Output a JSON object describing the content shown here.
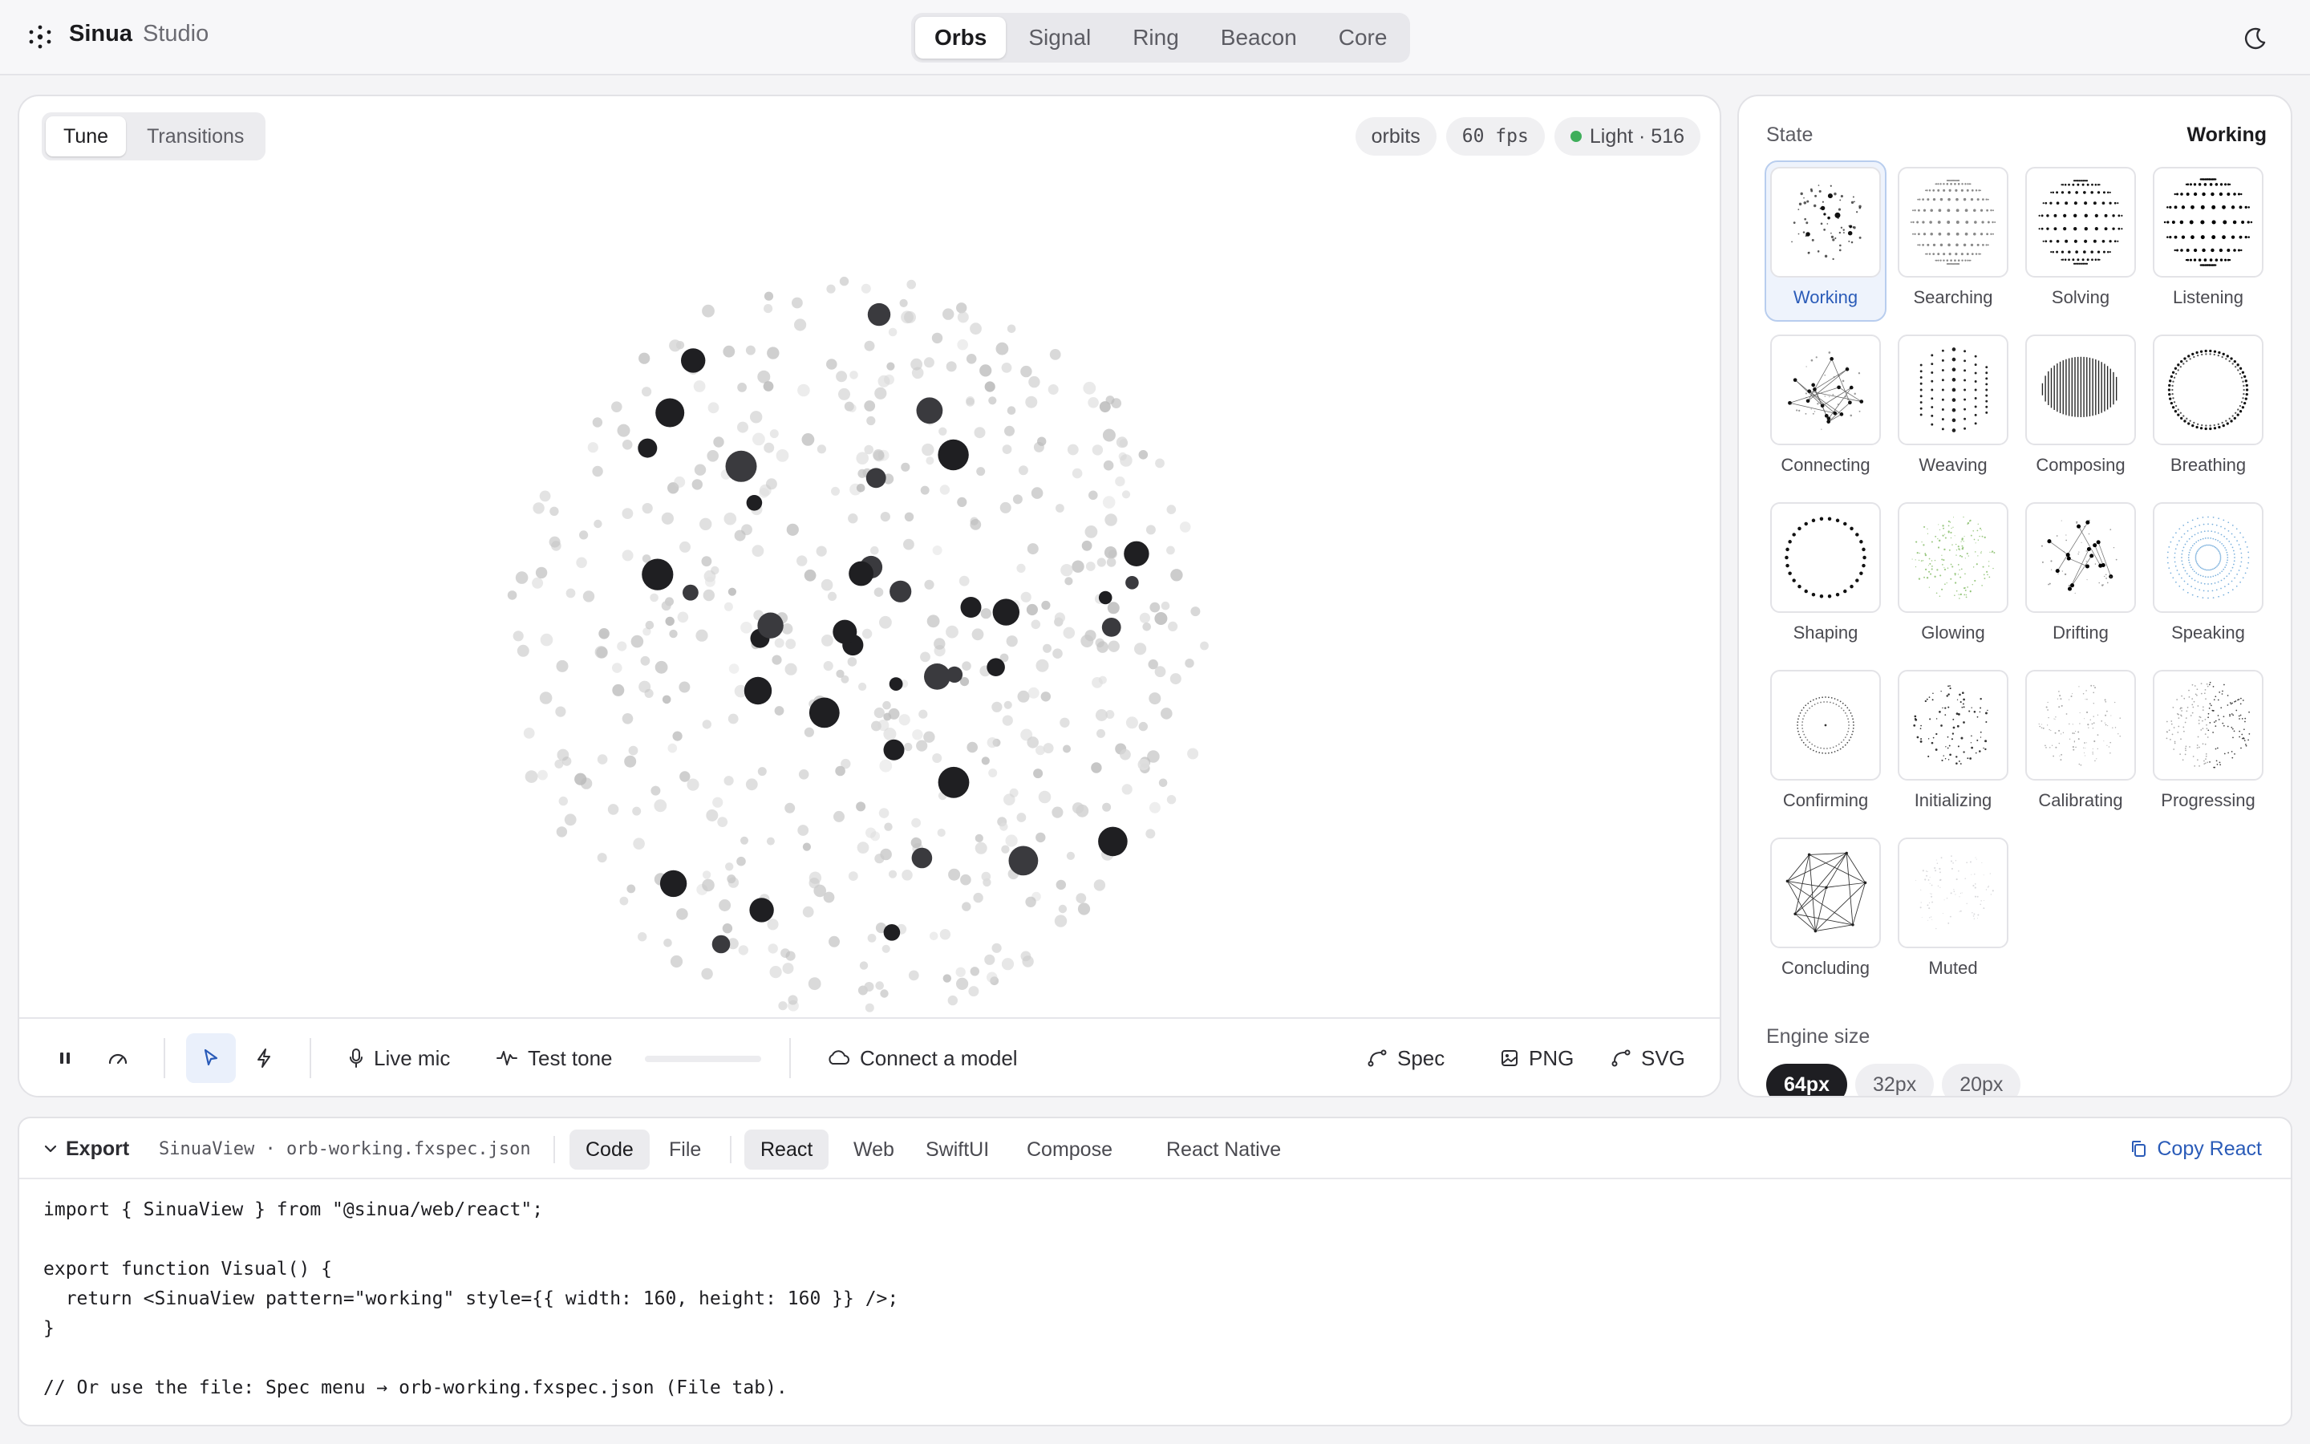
{
  "app": {
    "brand": "Sinua",
    "subtitle": "Studio"
  },
  "top_tabs": [
    {
      "label": "Orbs",
      "active": true
    },
    {
      "label": "Signal"
    },
    {
      "label": "Ring"
    },
    {
      "label": "Beacon"
    },
    {
      "label": "Core"
    }
  ],
  "theme_toggle_icon": "moon-icon",
  "canvas": {
    "mode_tabs": [
      {
        "label": "Tune",
        "active": true
      },
      {
        "label": "Transitions"
      }
    ],
    "pills": {
      "mode": "orbits",
      "fps": "60 fps",
      "light": "Light · 516"
    },
    "status_color": "#3fae5b"
  },
  "toolbar": {
    "live_mic": "Live mic",
    "test_tone": "Test tone",
    "connect_model": "Connect a model",
    "spec": "Spec",
    "png": "PNG",
    "svg": "SVG",
    "icons": [
      "pause-icon",
      "gauge-icon",
      "pointer-icon",
      "bolt-icon",
      "mic-icon",
      "waveform-icon",
      "cloud-icon",
      "curve-icon",
      "image-icon",
      "curve-icon"
    ]
  },
  "state_panel": {
    "title": "State",
    "current": "Working",
    "states": [
      "Working",
      "Searching",
      "Solving",
      "Listening",
      "Connecting",
      "Weaving",
      "Composing",
      "Breathing",
      "Shaping",
      "Glowing",
      "Drifting",
      "Speaking",
      "Confirming",
      "Initializing",
      "Calibrating",
      "Progressing",
      "Concluding",
      "Muted"
    ],
    "engine_label": "Engine size",
    "sizes": [
      {
        "label": "64px",
        "active": true
      },
      {
        "label": "32px"
      },
      {
        "label": "20px"
      }
    ]
  },
  "export": {
    "title": "Export",
    "file": "SinuaView · orb-working.fxspec.json",
    "view_tabs": [
      {
        "label": "Code",
        "active": true
      },
      {
        "label": "File"
      }
    ],
    "platform_tabs": [
      {
        "label": "React",
        "active": true
      },
      {
        "label": "Web"
      },
      {
        "label": "SwiftUI"
      },
      {
        "label": "Compose"
      },
      {
        "label": "React Native"
      }
    ],
    "copy": "Copy React",
    "code_lines": [
      "import { SinuaView } from \"@sinua/web/react\";",
      "",
      "export function Visual() {",
      "  return <SinuaView pattern=\"working\" style={{ width: 160, height: 160 }} />;",
      "}",
      "",
      "// Or use the file: Spec menu → orb-working.fxspec.json (File tab)."
    ]
  },
  "colors": {
    "accent": "#2a5bb8",
    "active_bg": "#eef3fc",
    "dark": "#1e1e22"
  }
}
